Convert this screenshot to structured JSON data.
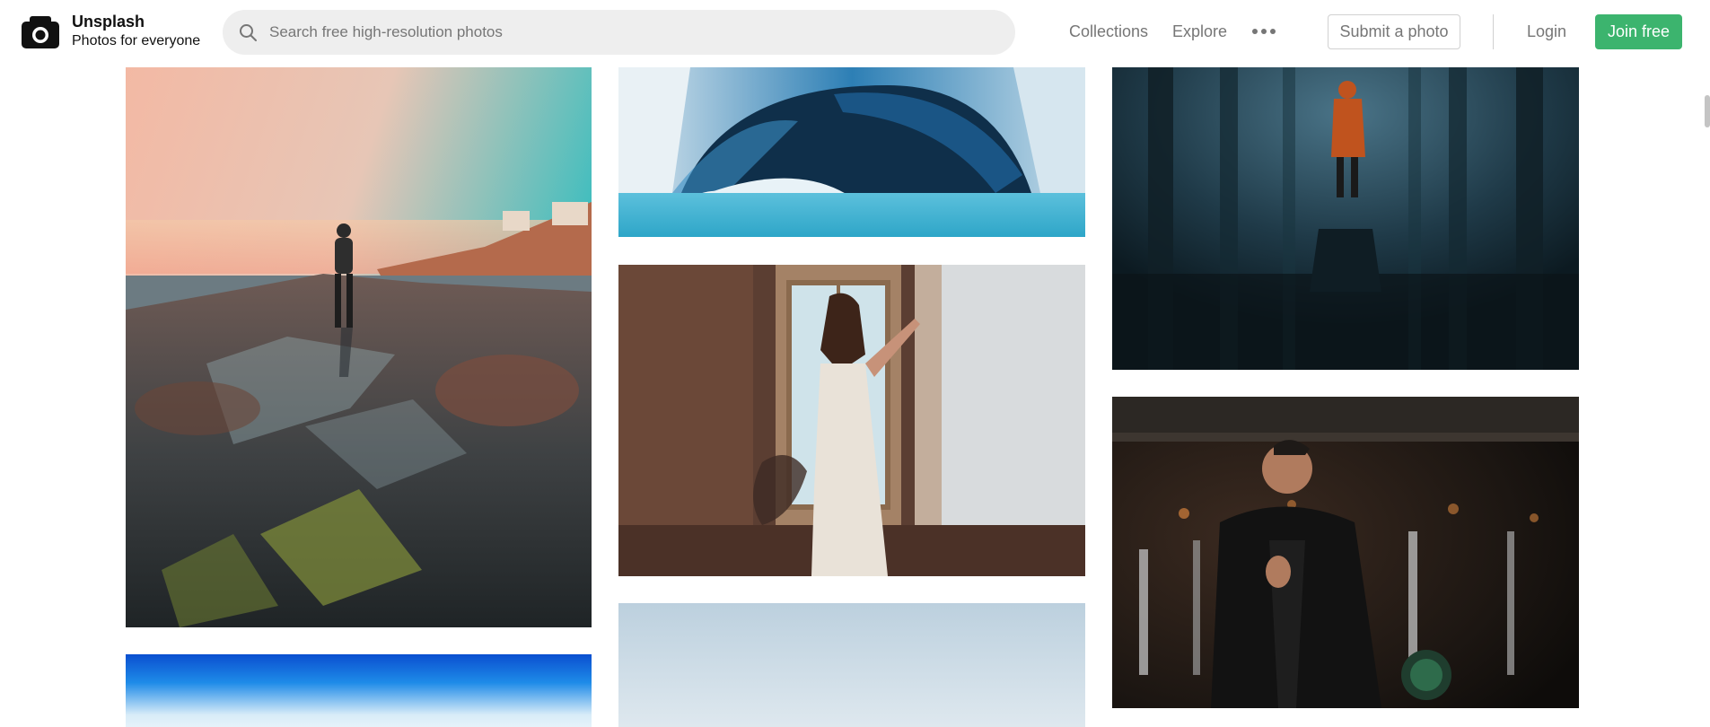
{
  "brand": {
    "name": "Unsplash",
    "tagline": "Photos for everyone",
    "logo_icon": "camera-icon"
  },
  "search": {
    "placeholder": "Search free high-resolution photos",
    "value": "",
    "icon": "search-icon"
  },
  "nav": {
    "collections": "Collections",
    "explore": "Explore",
    "more_icon": "more-dots-icon",
    "submit": "Submit a photo",
    "login": "Login",
    "join": "Join free"
  },
  "colors": {
    "accent": "#3cb46e",
    "muted_text": "#767676",
    "search_bg": "#eeeeee"
  },
  "photos": [
    {
      "subject": "hiker-on-rocky-shore-at-sunset",
      "column": 1
    },
    {
      "subject": "blue-sky-gradient",
      "column": 1
    },
    {
      "subject": "glacier-ice-cave",
      "column": 2
    },
    {
      "subject": "woman-at-window",
      "column": 2
    },
    {
      "subject": "pale-sky",
      "column": 2
    },
    {
      "subject": "person-in-foggy-forest",
      "column": 3
    },
    {
      "subject": "man-in-gym",
      "column": 3
    }
  ]
}
